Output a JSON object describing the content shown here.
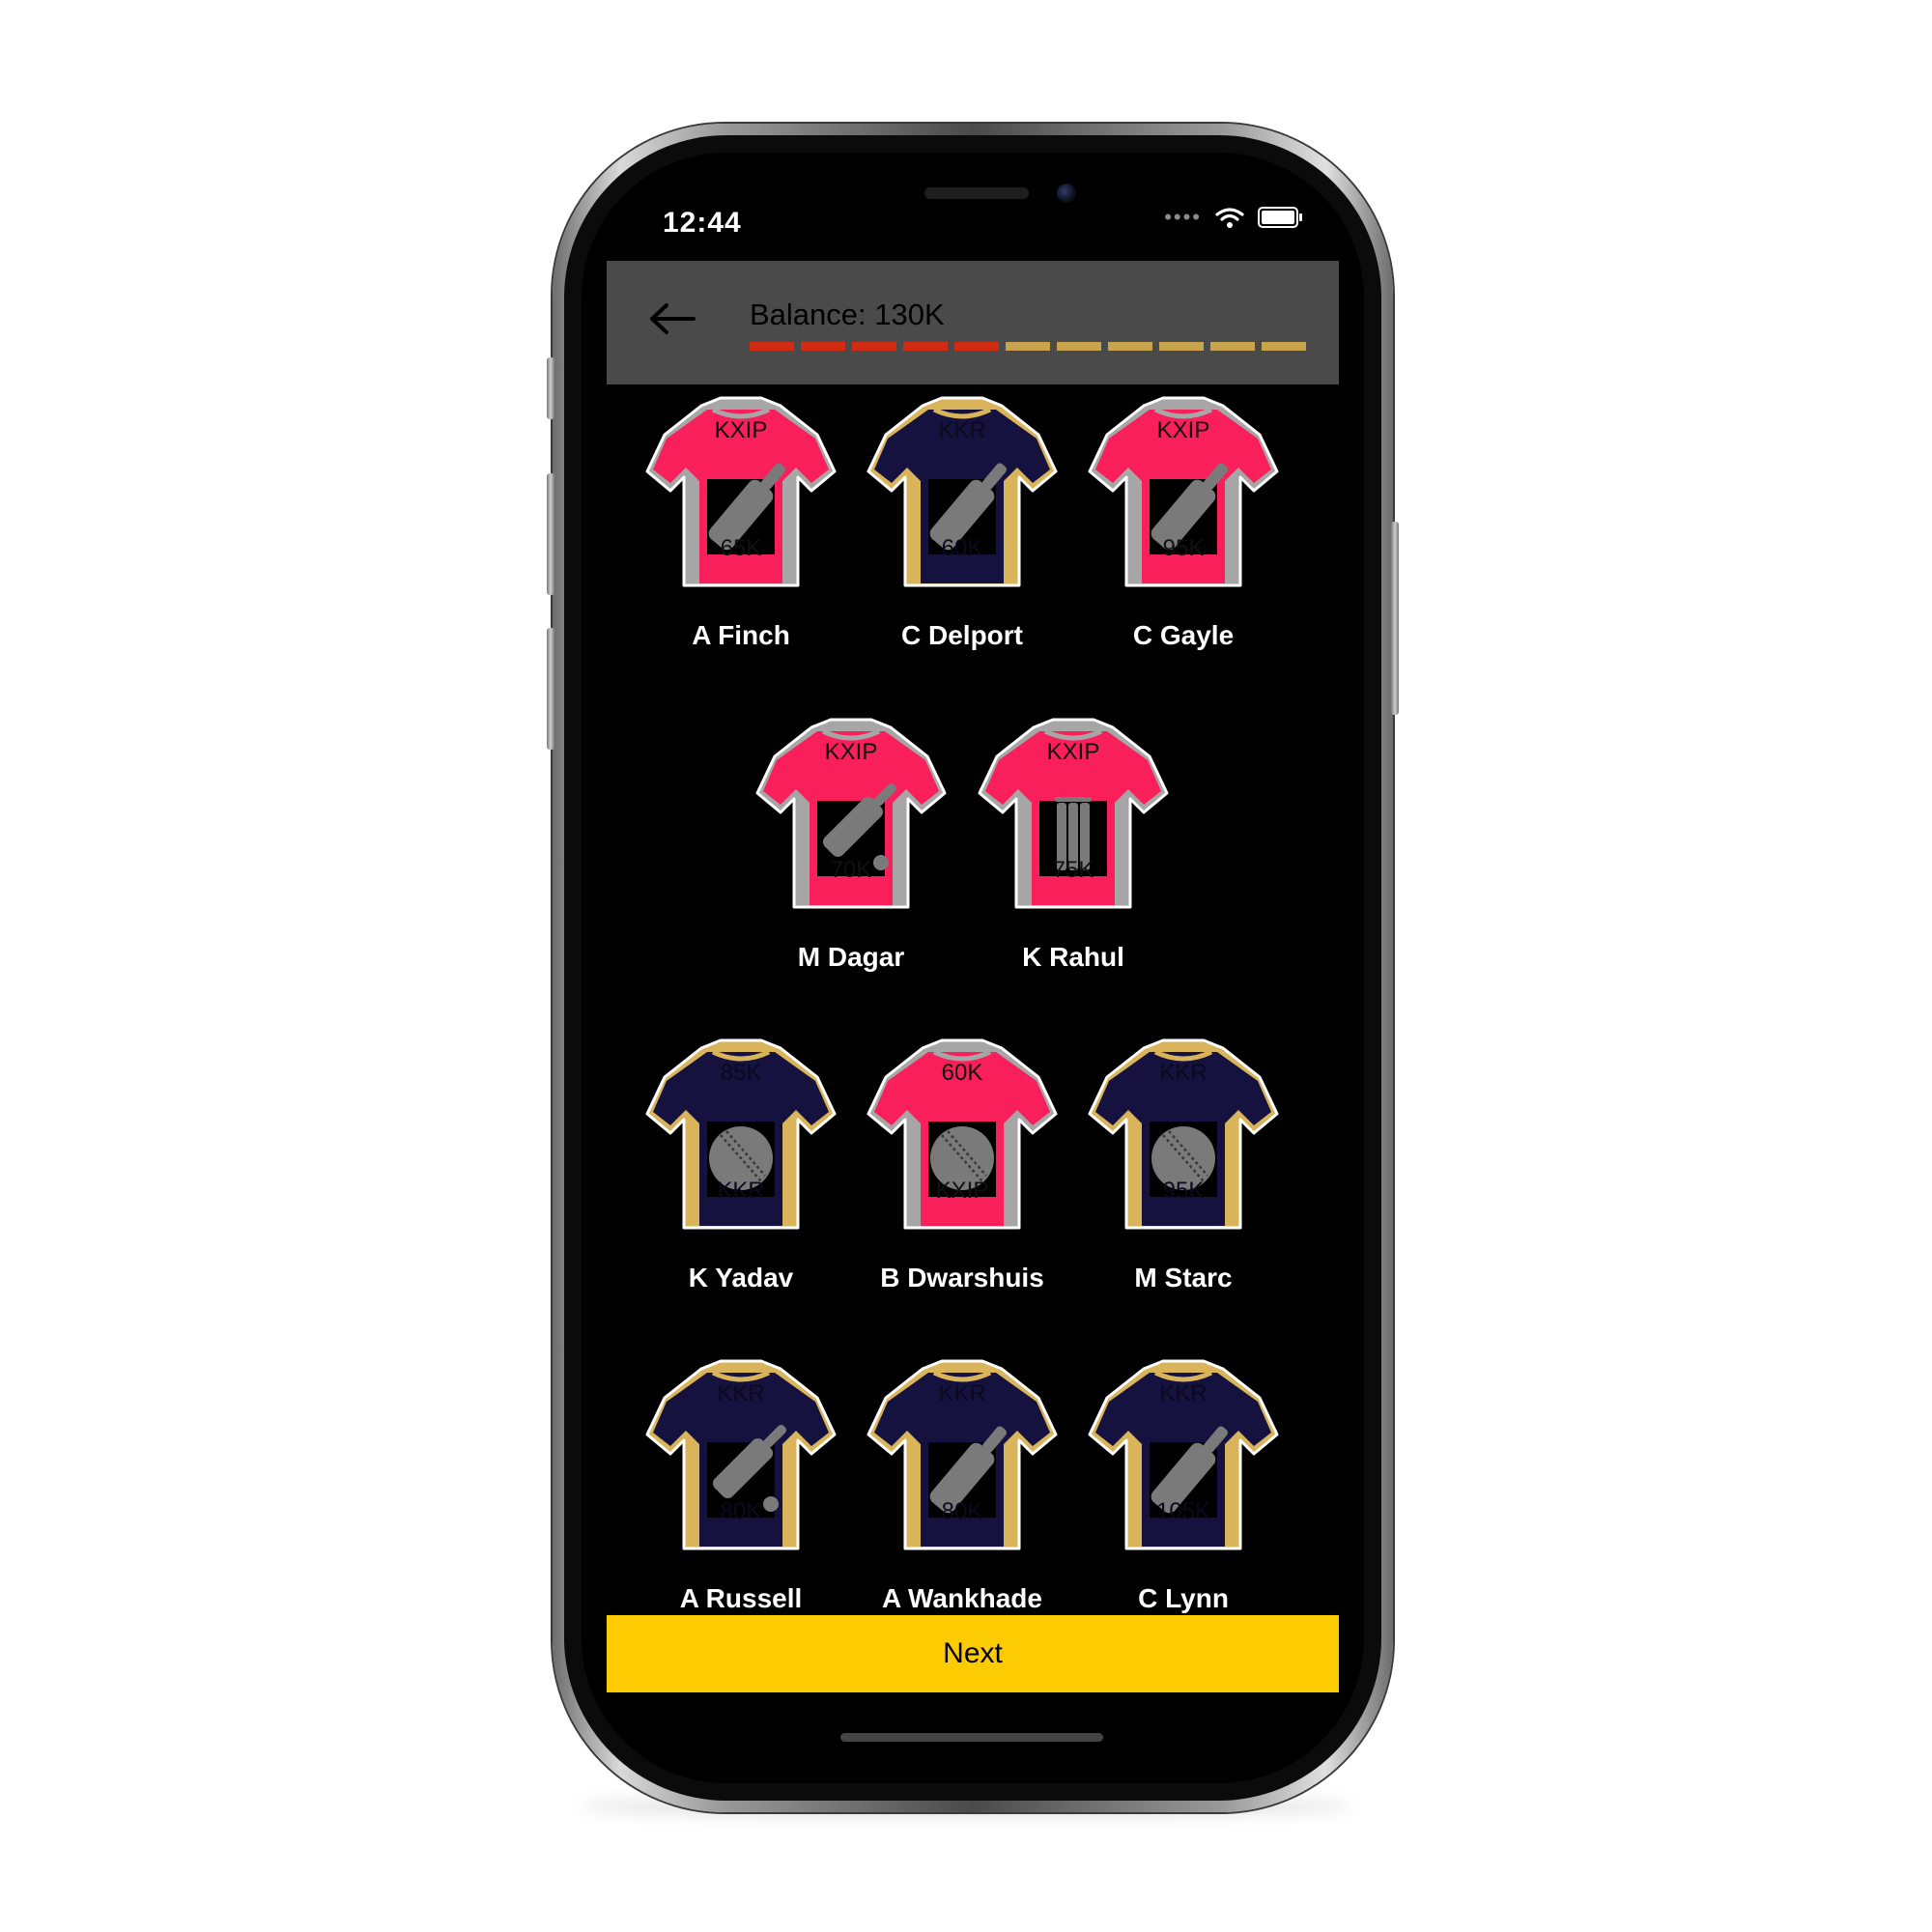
{
  "status_bar": {
    "time": "12:44"
  },
  "header": {
    "back_icon": "arrow-left-icon",
    "balance": "Balance: 130K",
    "budget_bar": {
      "filled_segments": 5,
      "total_segments": 11,
      "filled_color": "#d12b12",
      "empty_color": "#c8a44e"
    }
  },
  "colors": {
    "kxip_body": "#f81f5a",
    "kxip_trim": "#a6a6a6",
    "kkr_body": "#15123f",
    "kkr_trim": "#d9b45a",
    "header_bg": "#4a4a4a",
    "next_bg": "#fdcb02"
  },
  "players": [
    {
      "name": "A Finch",
      "team": "KXIP",
      "price": "65K",
      "top": "KXIP",
      "bottom": "65K",
      "role_icon": "bat-icon"
    },
    {
      "name": "C Delport",
      "team": "KKR",
      "price": "60K",
      "top": "KKR",
      "bottom": "60K",
      "role_icon": "bat-icon"
    },
    {
      "name": "C Gayle",
      "team": "KXIP",
      "price": "95K",
      "top": "KXIP",
      "bottom": "95K",
      "role_icon": "bat-icon"
    },
    {
      "name": "M Dagar",
      "team": "KXIP",
      "price": "70K",
      "top": "KXIP",
      "bottom": "70K",
      "role_icon": "bat-ball-icon"
    },
    {
      "name": "K Rahul",
      "team": "KXIP",
      "price": "75K",
      "top": "KXIP",
      "bottom": "75K",
      "role_icon": "wickets-icon"
    },
    {
      "name": "K Yadav",
      "team": "KKR",
      "price": "85K",
      "top": "85K",
      "bottom": "KKR",
      "role_icon": "ball-icon"
    },
    {
      "name": "B Dwarshuis",
      "team": "KXIP",
      "price": "60K",
      "top": "60K",
      "bottom": "KXIP",
      "role_icon": "ball-icon"
    },
    {
      "name": "M Starc",
      "team": "KKR",
      "price": "95K",
      "top": "KKR",
      "bottom": "95K",
      "role_icon": "ball-icon"
    },
    {
      "name": "A Russell",
      "team": "KKR",
      "price": "80K",
      "top": "KKR",
      "bottom": "80K",
      "role_icon": "bat-ball-icon"
    },
    {
      "name": "A Wankhade",
      "team": "KKR",
      "price": "80K",
      "top": "KKR",
      "bottom": "80K",
      "role_icon": "bat-icon"
    },
    {
      "name": "C Lynn",
      "team": "KKR",
      "price": "105K",
      "top": "KKR",
      "bottom": "105K",
      "role_icon": "bat-icon"
    }
  ],
  "next_button": {
    "label": "Next"
  }
}
